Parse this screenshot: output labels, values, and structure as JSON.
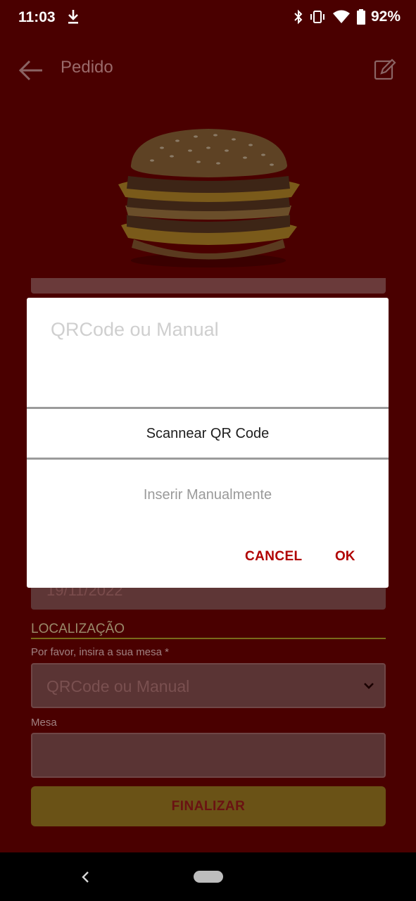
{
  "status_bar": {
    "time": "11:03",
    "battery": "92%",
    "icons": [
      "download-icon",
      "bluetooth-icon",
      "vibrate-icon",
      "wifi-icon",
      "battery-icon"
    ]
  },
  "app_bar": {
    "title": "Pedido"
  },
  "form": {
    "date_value": "19/11/2022",
    "section_title": "LOCALIZAÇÃO",
    "mesa_select_label": "Por favor, insira a sua mesa *",
    "mesa_select_value": "QRCode ou Manual",
    "mesa_label": "Mesa",
    "mesa_value": "",
    "finalize_label": "FINALIZAR"
  },
  "dialog": {
    "title": "QRCode ou Manual",
    "options": [
      "Scannear QR Code",
      "Inserir Manualmente"
    ],
    "cancel_label": "CANCEL",
    "ok_label": "OK"
  },
  "colors": {
    "background_dim": "#4a0000",
    "accent_red": "#b00000",
    "finalize_gold": "#6a5216"
  }
}
